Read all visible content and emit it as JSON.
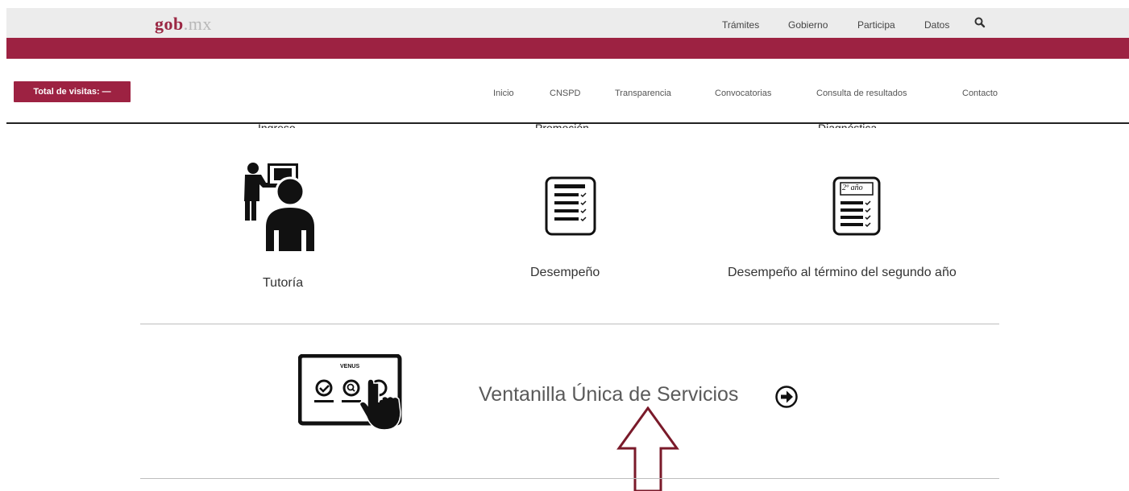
{
  "header": {
    "logo_bold": "gob",
    "logo_dim": ".mx",
    "links": [
      "Trámites",
      "Gobierno",
      "Participa",
      "Datos"
    ],
    "search_icon": "search-icon"
  },
  "visits": {
    "label": "Total de visitas: —"
  },
  "nav": [
    "Inicio",
    "CNSPD",
    "Transparencia",
    "Convocatorias",
    "Consulta de resultados",
    "Contacto"
  ],
  "clipped_labels": [
    "Ingreso",
    "Promoción",
    "Diagnóstica"
  ],
  "cards": [
    {
      "icon": "teacher-tutor-icon",
      "label": "Tutoría"
    },
    {
      "icon": "checklist-icon",
      "label": "Desempeño"
    },
    {
      "icon": "checklist-second-year-icon",
      "label": "Desempeño al término del segundo año",
      "badge": "2º año"
    }
  ],
  "venus": {
    "screen_label": "VENUS",
    "link_text": "Ventanilla Única de Servicios",
    "arrow_icon": "arrow-right-circle-icon",
    "annotation_icon": "up-arrow-annotation-icon"
  },
  "colors": {
    "brand": "#9d2242",
    "logo_dim": "#b8b8b8",
    "header_bg": "#ececec"
  }
}
